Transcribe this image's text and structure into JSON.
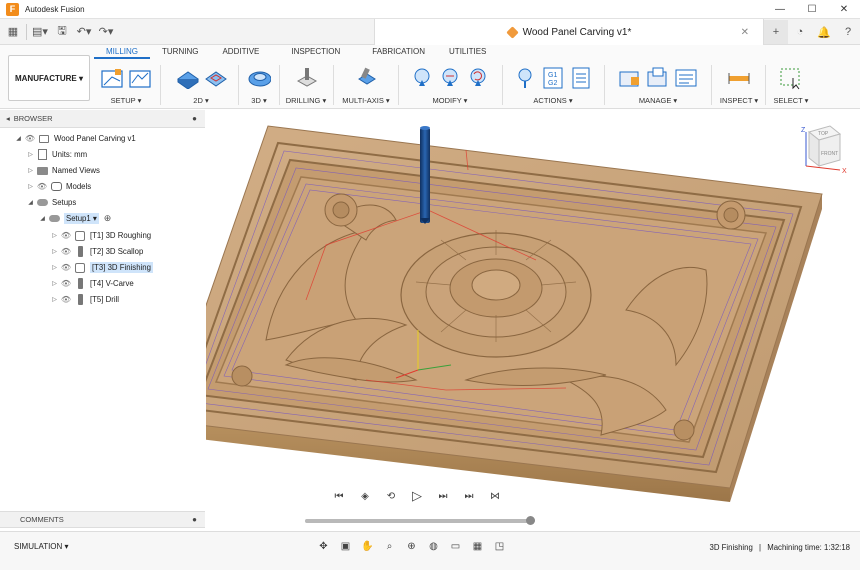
{
  "app": {
    "title": "Autodesk Fusion",
    "logo_letter": "F"
  },
  "document": {
    "name": "Wood Panel Carving v1*"
  },
  "ribbon": {
    "tabs": [
      "MILLING",
      "TURNING",
      "ADDITIVE",
      "INSPECTION",
      "FABRICATION",
      "UTILITIES"
    ],
    "workspace": "MANUFACTURE ▾",
    "groups": {
      "setup": "SETUP ▾",
      "twod": "2D ▾",
      "threed": "3D ▾",
      "drilling": "DRILLING ▾",
      "multiaxis": "MULTI-AXIS ▾",
      "modify": "MODIFY ▾",
      "actions": "ACTIONS ▾",
      "manage": "MANAGE ▾",
      "inspect": "INSPECT ▾",
      "select": "SELECT ▾"
    },
    "gcode_label_1": "G1",
    "gcode_label_2": "G2"
  },
  "browser": {
    "title": "BROWSER",
    "root": "Wood Panel Carving v1",
    "units": "Units: mm",
    "named_views": "Named Views",
    "models": "Models",
    "setups": "Setups",
    "setup1": "Setup1 ▾",
    "ops": [
      "[T1] 3D Roughing",
      "[T2] 3D Scallop",
      "[T3] 3D Finishing",
      "[T4] V-Carve",
      "[T5] Drill"
    ]
  },
  "comments": {
    "title": "COMMENTS"
  },
  "viewcube": {
    "top": "TOP",
    "front": "FRONT",
    "axis_x": "X",
    "axis_z": "Z"
  },
  "bottom": {
    "simulation": "SIMULATION ▾",
    "status_op": "3D Finishing",
    "status_sep": "|",
    "status_time": "Machining time: 1:32:18"
  },
  "colors": {
    "accent": "#1f6fc7",
    "wood": "#c9a57e",
    "wood_dark": "#9a7650",
    "toolpath": "#6f4fc9",
    "rapid": "#e03a2e",
    "tool": "#1d4d8f",
    "selection": "#cfe4fa"
  }
}
